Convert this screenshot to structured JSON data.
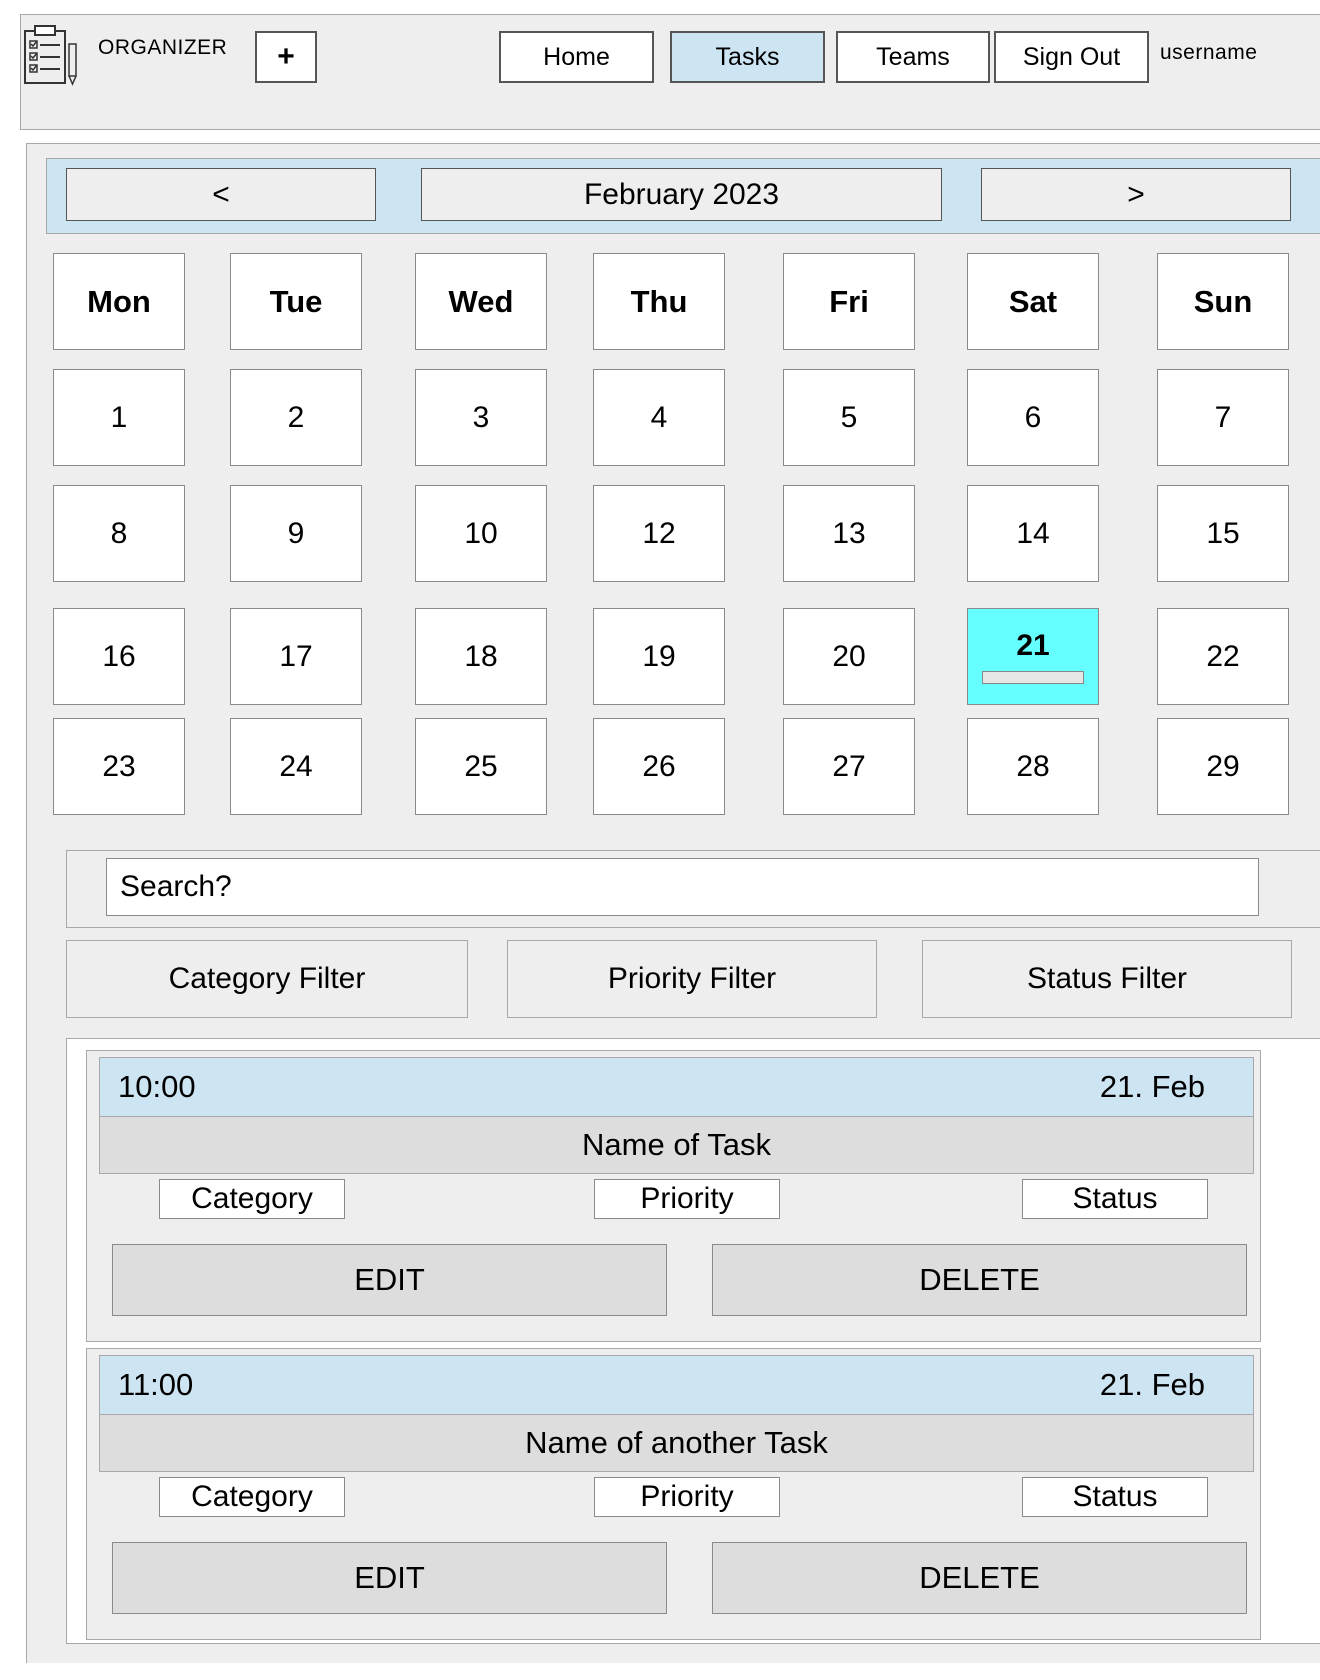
{
  "header": {
    "app_title": "ORGANIZER",
    "add_label": "+",
    "nav": {
      "home": "Home",
      "tasks": "Tasks",
      "teams": "Teams",
      "sign_out": "Sign Out"
    },
    "username": "username",
    "logo_icon": "clipboard-checklist-icon"
  },
  "calendar": {
    "prev_label": "<",
    "next_label": ">",
    "month_label": "February 2023",
    "weekdays": [
      "Mon",
      "Tue",
      "Wed",
      "Thu",
      "Fri",
      "Sat",
      "Sun"
    ],
    "weeks": [
      [
        "1",
        "2",
        "3",
        "4",
        "5",
        "6",
        "7"
      ],
      [
        "8",
        "9",
        "10",
        "12",
        "13",
        "14",
        "15"
      ],
      [
        "16",
        "17",
        "18",
        "19",
        "20",
        "21",
        "22"
      ],
      [
        "23",
        "24",
        "25",
        "26",
        "27",
        "28",
        "29"
      ]
    ],
    "selected_day": "21",
    "selected_color": "#66ffff"
  },
  "search": {
    "placeholder": "Search?"
  },
  "filters": {
    "category": "Category Filter",
    "priority": "Priority Filter",
    "status": "Status Filter"
  },
  "tasks": [
    {
      "time": "10:00",
      "date": "21. Feb",
      "name": "Name of Task",
      "category": "Category",
      "priority": "Priority",
      "status": "Status",
      "edit": "EDIT",
      "delete": "DELETE"
    },
    {
      "time": "11:00",
      "date": "21. Feb",
      "name": "Name of another Task",
      "category": "Category",
      "priority": "Priority",
      "status": "Status",
      "edit": "EDIT",
      "delete": "DELETE"
    }
  ],
  "colors": {
    "accent": "#cde4f2",
    "panel": "#eeeeee",
    "button_gray": "#dddddd"
  }
}
